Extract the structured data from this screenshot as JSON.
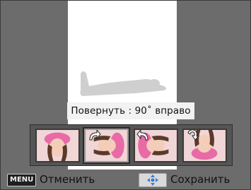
{
  "caption": "Повернуть : 90˚ вправо",
  "thumbnails": [
    {
      "rotation": "none",
      "icon": "none"
    },
    {
      "rotation": "90 right",
      "icon": "rotate-right-icon",
      "selected": true
    },
    {
      "rotation": "90 left",
      "icon": "rotate-left-icon"
    },
    {
      "rotation": "180",
      "icon": "rotate-180-icon"
    }
  ],
  "bottom_bar": {
    "menu_key": "MENU",
    "cancel_label": "Отменить",
    "nav_icon": "dpad-icon",
    "save_label": "Сохранить"
  },
  "colors": {
    "background": "#6c6c6c",
    "preview": "#ffffff",
    "caption_bg": "#f2f2f2",
    "strip": "#555555"
  }
}
